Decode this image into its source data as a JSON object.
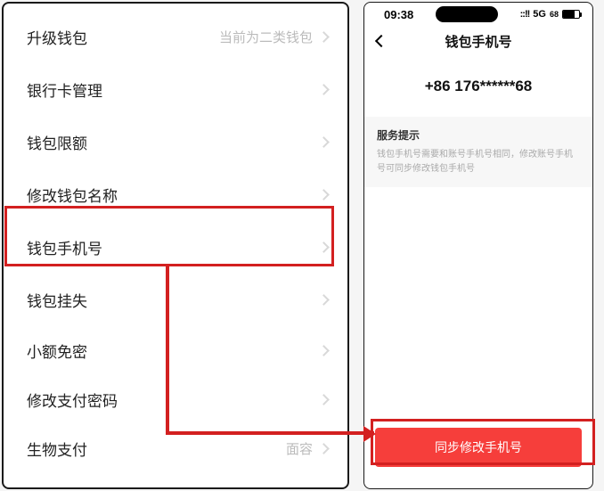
{
  "left": {
    "items": [
      {
        "label": "升级钱包",
        "extra": "当前为二类钱包"
      },
      {
        "label": "银行卡管理",
        "extra": ""
      },
      {
        "label": "钱包限额",
        "extra": ""
      },
      {
        "label": "修改钱包名称",
        "extra": ""
      },
      {
        "label": "钱包手机号",
        "extra": ""
      },
      {
        "label": "钱包挂失",
        "extra": ""
      },
      {
        "label": "小额免密",
        "extra": ""
      },
      {
        "label": "修改支付密码",
        "extra": ""
      },
      {
        "label": "生物支付",
        "extra": "面容"
      }
    ]
  },
  "right": {
    "status": {
      "time": "09:38",
      "network": "5G",
      "battery_text": "68"
    },
    "nav": {
      "title": "钱包手机号"
    },
    "phone_number": "+86 176******68",
    "notice": {
      "title": "服务提示",
      "text": "钱包手机号需要和账号手机号相同，修改账号手机号可同步修改钱包手机号"
    },
    "button": {
      "label": "同步修改手机号"
    }
  },
  "colors": {
    "primary_button": "#f63e3b",
    "annotation": "#d32020"
  }
}
